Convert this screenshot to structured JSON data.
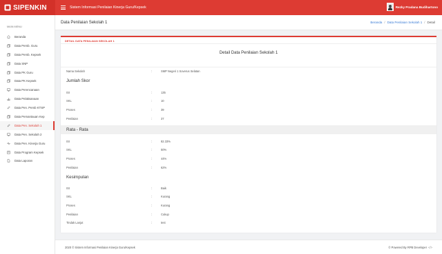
{
  "brand": {
    "name": "SIPENKIN"
  },
  "topbar": {
    "app_title": "Sistem Informasi Penilaian Kinerja Guru/Kepsek",
    "user_name": "Rezky Pradana Budihartono"
  },
  "sidebar": {
    "heading": "MAIN MENU",
    "items": [
      {
        "label": "Beranda",
        "icon": "home-icon"
      },
      {
        "label": "Data Pemb. Guru",
        "icon": "copy-icon"
      },
      {
        "label": "Data Pemb. Kepsek",
        "icon": "copy-icon"
      },
      {
        "label": "Data SNP",
        "icon": "copy-icon"
      },
      {
        "label": "Data PK Guru",
        "icon": "copy-icon"
      },
      {
        "label": "Data PK Kepsek",
        "icon": "copy-icon"
      },
      {
        "label": "Data Perencanaan",
        "icon": "monitor-icon"
      },
      {
        "label": "Data Pelaksanaan",
        "icon": "bar-chart-icon"
      },
      {
        "label": "Data Pen. Pemb KTSP",
        "icon": "pencil-icon"
      },
      {
        "label": "Data Pemantauan Kep",
        "icon": "copy-icon"
      },
      {
        "label": "Data Pen. Sekolah 1",
        "icon": "pencil-icon",
        "active": true
      },
      {
        "label": "Data Pen. Sekolah 2",
        "icon": "monitor-icon"
      },
      {
        "label": "Data Pen. Kinerja Guru",
        "icon": "pulse-icon"
      },
      {
        "label": "Data Program Kepsek",
        "icon": "book-icon"
      },
      {
        "label": "Data Laporan",
        "icon": "file-icon"
      }
    ]
  },
  "header": {
    "title": "Data Penilaian Sekolah 1",
    "breadcrumb": [
      "Beranda",
      "Data Penilaian Sekolah 1",
      "Detail"
    ]
  },
  "card": {
    "label": "DETAIL DATA PENILAIAN SEKOLAH 1",
    "title": "Detail Data Penilaian Sekolah 1",
    "school": {
      "key": "Nama Sekolah",
      "value": "SMP Negeri 1 Soverus Selatan"
    },
    "sections": [
      {
        "title": "Jumlah Skor",
        "rows": [
          {
            "key": "ISI",
            "value": "135"
          },
          {
            "key": "SKL",
            "value": "10"
          },
          {
            "key": "Proses",
            "value": "39"
          },
          {
            "key": "Penilaian",
            "value": "37"
          }
        ]
      },
      {
        "title": "Rata - Rata",
        "rows": [
          {
            "key": "ISI",
            "value": "82.33%"
          },
          {
            "key": "SKL",
            "value": "50%"
          },
          {
            "key": "Proses",
            "value": "44%"
          },
          {
            "key": "Penilaian",
            "value": "62%"
          }
        ]
      },
      {
        "title": "Kesimpulan",
        "rows": [
          {
            "key": "ISI",
            "value": "Baik"
          },
          {
            "key": "SKL",
            "value": "Kurang"
          },
          {
            "key": "Proses",
            "value": "Kurang"
          },
          {
            "key": "Penilaian",
            "value": "Cukup"
          },
          {
            "key": "Tindak Lanjut",
            "value": "test"
          }
        ]
      }
    ],
    "separator": ":"
  },
  "footer": {
    "copyright": "2020 © Sistem Informasi Penilaian Kinerja Guru/Kepsek",
    "powered": "© Powered By RPB Developer",
    "powered_icon": "code-icon"
  },
  "colors": {
    "accent": "#dd3b33",
    "link": "#3a7bd5"
  }
}
